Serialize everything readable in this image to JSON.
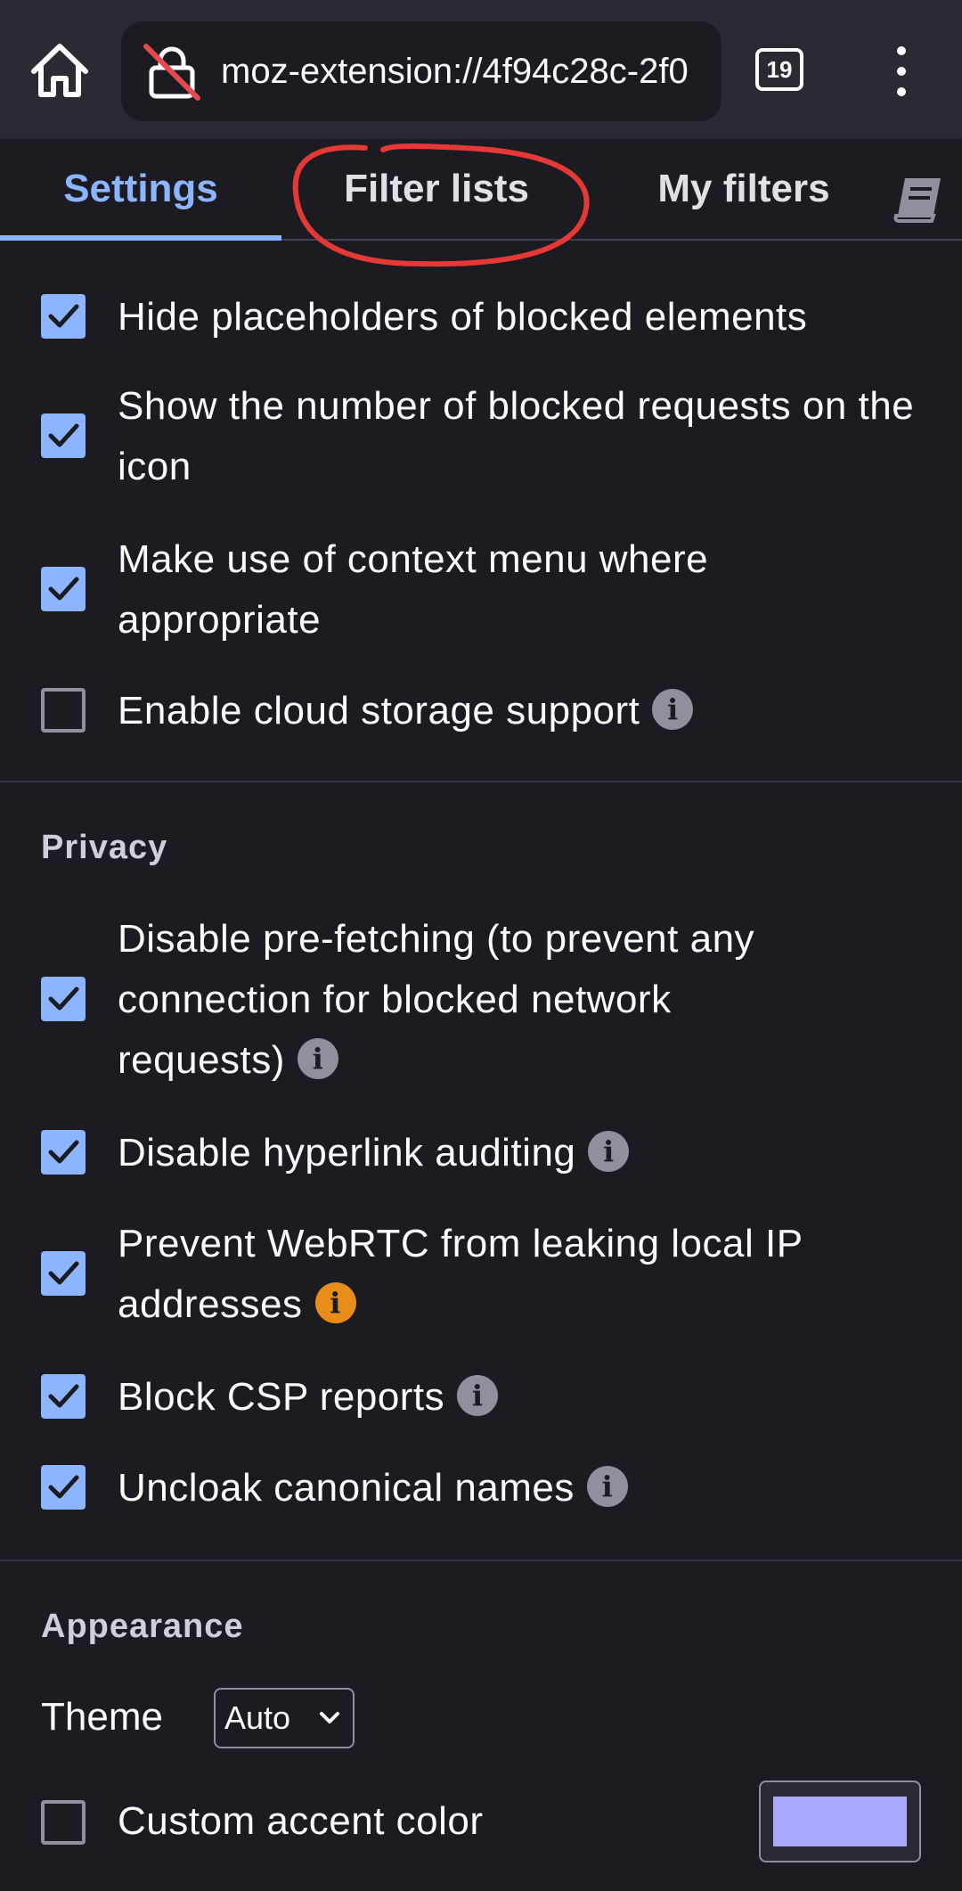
{
  "browser": {
    "url": "moz-extension://4f94c28c-2f0",
    "tab_count": "19",
    "icons": [
      "home-icon",
      "lock-crossed-icon",
      "tabs-counter-icon",
      "kebab-menu-icon"
    ]
  },
  "tabs": [
    {
      "label": "Settings",
      "active": true
    },
    {
      "label": "Filter lists",
      "active": false
    },
    {
      "label": "My filters",
      "active": false
    },
    {
      "label": "",
      "icon": "book-icon"
    }
  ],
  "general": {
    "items": [
      {
        "label": "Hide placeholders of blocked elements",
        "checked": true
      },
      {
        "label": "Show the number of blocked requests on the icon",
        "checked": true
      },
      {
        "label": "Make use of context menu where appropriate",
        "checked": true
      },
      {
        "label": "Enable cloud storage support",
        "checked": false,
        "info": true
      }
    ]
  },
  "privacy": {
    "title": "Privacy",
    "items": [
      {
        "label": "Disable pre-fetching (to prevent any connection for blocked network requests)",
        "checked": true,
        "info": true
      },
      {
        "label": "Disable hyperlink auditing",
        "checked": true,
        "info": true
      },
      {
        "label": "Prevent WebRTC from leaking local IP addresses",
        "checked": true,
        "info": "warning"
      },
      {
        "label": "Block CSP reports",
        "checked": true,
        "info": true
      },
      {
        "label": "Uncloak canonical names",
        "checked": true,
        "info": true
      }
    ]
  },
  "appearance": {
    "title": "Appearance",
    "theme_label": "Theme",
    "theme_value": "Auto",
    "accent_label": "Custom accent color",
    "accent_checked": false,
    "accent_color": "#aaa8ff"
  },
  "colors": {
    "background": "#1c1b22",
    "toolbar": "#2b2a33",
    "accent": "#8cb4ff",
    "warning": "#e88d1a",
    "annotation": "#e53935"
  }
}
